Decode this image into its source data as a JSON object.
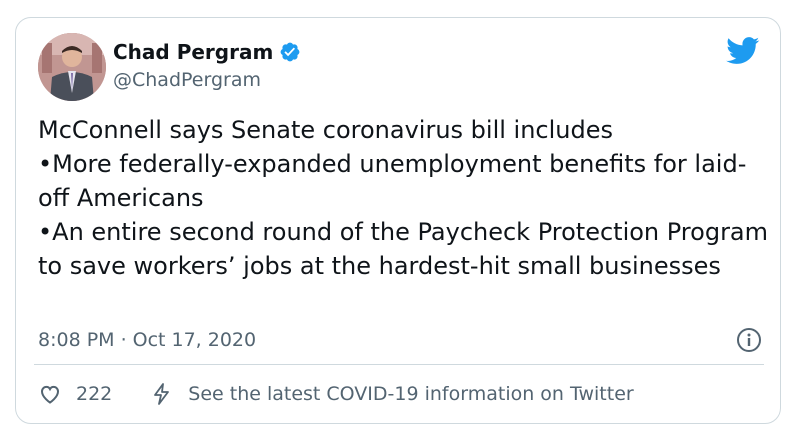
{
  "author": {
    "name": "Chad Pergram",
    "handle": "@ChadPergram",
    "verified": true
  },
  "tweet": {
    "text": "McConnell says Senate coronavirus bill includes\n•More federally-expanded unemployment benefits for laid-off Americans\n•An entire second round of the Paycheck Protection Program to save workers’ jobs at the hardest-hit small businesses",
    "time": "8:08 PM",
    "separator": "·",
    "date": "Oct 17, 2020"
  },
  "actions": {
    "likes": "222",
    "covid_info": "See the latest COVID-19 information on Twitter"
  },
  "colors": {
    "brand_blue": "#1d9bf0",
    "muted": "#536471",
    "border": "#cfd9de",
    "verified": "#1d9bf0"
  },
  "icons": {
    "brand": "twitter-bird-icon",
    "verified": "verified-badge-icon",
    "info": "info-icon",
    "like": "heart-icon",
    "covid": "lightning-bolt-icon"
  }
}
